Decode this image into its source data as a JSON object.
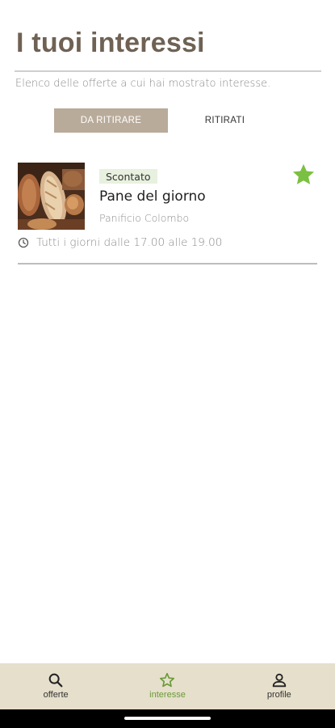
{
  "header": {
    "title": "I tuoi interessi",
    "subtitle": "Elenco delle offerte a cui hai mostrato interesse."
  },
  "tabs": [
    {
      "label": "DA RITIRARE",
      "active": true
    },
    {
      "label": "RITIRATI",
      "active": false
    }
  ],
  "offers": [
    {
      "badge": "Scontato",
      "name": "Pane del giorno",
      "shop": "Panificio Colombo",
      "schedule": "Tutti i giorni dalle 17.00 alle 19.00",
      "favorite": true,
      "icons": {
        "favorite": "star-icon",
        "schedule": "clock-icon"
      }
    }
  ],
  "bottom_nav": {
    "items": [
      {
        "label": "offerte",
        "icon": "search-icon",
        "active": false
      },
      {
        "label": "interesse",
        "icon": "star-outline-icon",
        "active": true
      },
      {
        "label": "profile",
        "icon": "person-icon",
        "active": false
      }
    ]
  },
  "colors": {
    "title": "#6f6254",
    "tab_active_bg": "#b9ab9a",
    "badge_bg": "#e8f0df",
    "star": "#7cc043",
    "nav_bg": "#e6dfcb",
    "nav_active": "#6a9a38"
  }
}
